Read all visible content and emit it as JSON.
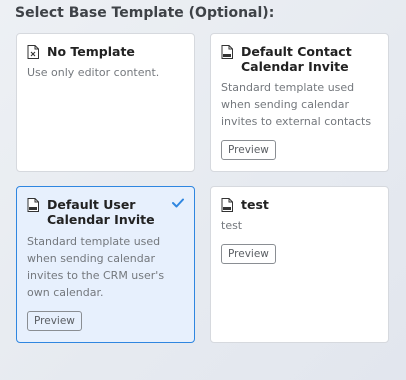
{
  "heading": "Select Base Template (Optional):",
  "colors": {
    "accent": "#2f86e0",
    "selected_bg": "#e7f0fd"
  },
  "templates": [
    {
      "title": "No Template",
      "description": "Use only editor content.",
      "icon": "file-x-icon",
      "selected": false
    },
    {
      "title": "Default Contact Calendar Invite",
      "description": "Standard template used when sending calendar invites to external contacts",
      "icon": "html-file-icon",
      "preview_label": "Preview",
      "selected": false
    },
    {
      "title": "Default User Calendar Invite",
      "description": "Standard template used when sending calendar invites to the CRM user's own calendar.",
      "icon": "html-file-icon",
      "preview_label": "Preview",
      "selected": true
    },
    {
      "title": "test",
      "description": "test",
      "icon": "html-file-icon",
      "preview_label": "Preview",
      "selected": false
    }
  ]
}
